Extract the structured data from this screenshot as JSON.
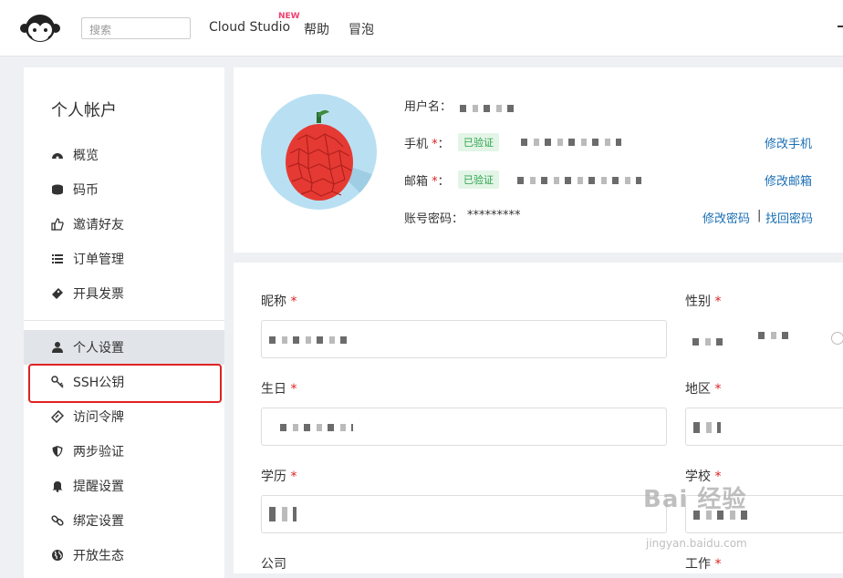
{
  "topbar": {
    "search_placeholder": "搜索",
    "nav": [
      "Cloud Studio",
      "帮助",
      "冒泡"
    ],
    "new_badge": "NEW"
  },
  "sidebar": {
    "title": "个人帐户",
    "items": [
      {
        "label": "概览",
        "icon": "dashboard-icon"
      },
      {
        "label": "码币",
        "icon": "coin-stack-icon"
      },
      {
        "label": "邀请好友",
        "icon": "thumbs-up-icon"
      },
      {
        "label": "订单管理",
        "icon": "list-icon"
      },
      {
        "label": "开具发票",
        "icon": "ticket-icon"
      },
      {
        "label": "个人设置",
        "icon": "user-icon",
        "active": true
      },
      {
        "label": "SSH公钥",
        "icon": "key-icon",
        "highlighted": true
      },
      {
        "label": "访问令牌",
        "icon": "token-icon"
      },
      {
        "label": "两步验证",
        "icon": "shield-icon"
      },
      {
        "label": "提醒设置",
        "icon": "bell-icon"
      },
      {
        "label": "绑定设置",
        "icon": "link-icon"
      },
      {
        "label": "开放生态",
        "icon": "globe-icon"
      }
    ]
  },
  "account": {
    "username_label": "用户名：",
    "phone_label": "手机",
    "email_label": "邮箱",
    "password_label": "账号密码：",
    "password_mask": "*********",
    "required_mark": "*",
    "colon": "：",
    "verified": "已验证",
    "change_phone": "修改手机",
    "change_email": "修改邮箱",
    "change_password": "修改密码",
    "separator": "|",
    "recover_password": "找回密码"
  },
  "profile_form": {
    "nickname": "昵称",
    "gender": "性别",
    "birthday": "生日",
    "region": "地区",
    "education": "学历",
    "school": "学校",
    "company": "公司",
    "job": "工作"
  },
  "watermark": {
    "main": "Bai 经验",
    "sub": "jingyan.baidu.com"
  },
  "colors": {
    "accent_link": "#1a6fb5",
    "required": "#e02121",
    "verified_text": "#2ea44f",
    "verified_bg": "#e3f5e6",
    "highlight_box": "#e02121",
    "sidebar_active": "#e1e5ea"
  }
}
